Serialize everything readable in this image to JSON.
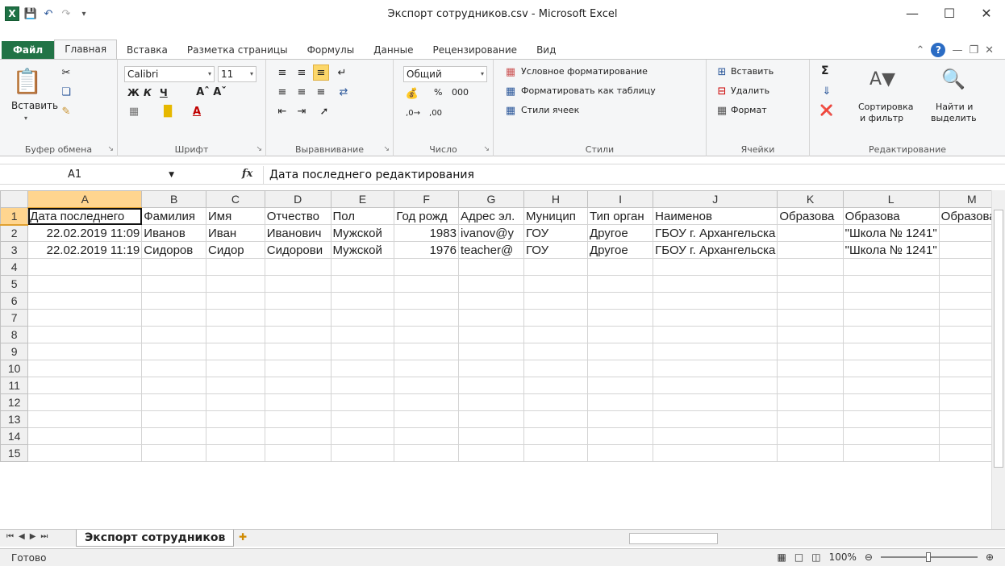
{
  "window": {
    "title": "Экспорт сотрудников.csv - Microsoft Excel",
    "app_icon": "X"
  },
  "ribbon_tabs": [
    "Файл",
    "Главная",
    "Вставка",
    "Разметка страницы",
    "Формулы",
    "Данные",
    "Рецензирование",
    "Вид"
  ],
  "ribbon": {
    "clipboard": {
      "paste": "Вставить",
      "label": "Буфер обмена"
    },
    "font": {
      "name": "Calibri",
      "size": "11",
      "label": "Шрифт",
      "bold": "Ж",
      "italic": "К",
      "underline": "Ч"
    },
    "alignment": {
      "label": "Выравнивание"
    },
    "number": {
      "format": "Общий",
      "percent": "%",
      "thousands": "000",
      "label": "Число"
    },
    "styles": {
      "conditional": "Условное форматирование",
      "as_table": "Форматировать как таблицу",
      "cell_styles": "Стили ячеек",
      "label": "Стили"
    },
    "cells": {
      "insert": "Вставить",
      "delete": "Удалить",
      "format": "Формат",
      "label": "Ячейки"
    },
    "editing": {
      "sum": "Σ",
      "sort_line1": "Сортировка",
      "sort_line2": "и фильтр",
      "find_line1": "Найти и",
      "find_line2": "выделить",
      "label": "Редактирование"
    }
  },
  "formula_bar": {
    "name_box": "A1",
    "fx": "fx",
    "content": "Дата последнего редактирования"
  },
  "sheet": {
    "columns": [
      "A",
      "B",
      "C",
      "D",
      "E",
      "F",
      "G",
      "H",
      "I",
      "J",
      "K",
      "L",
      "M"
    ],
    "row_numbers": [
      "1",
      "2",
      "3",
      "4",
      "5",
      "6",
      "7",
      "8",
      "9",
      "10",
      "11",
      "12",
      "13",
      "14",
      "15"
    ],
    "rows": [
      [
        "Дата последнего",
        "Фамилия",
        "Имя",
        "Отчество",
        "Пол",
        "Год рожд",
        "Адрес эл.",
        "Муницип",
        "Тип орган",
        "Наименов",
        "Образова",
        "Образова",
        "Образова"
      ],
      [
        "22.02.2019 11:09",
        "Иванов",
        "Иван",
        "Иванович",
        "Мужской",
        "1983",
        "ivanov@y",
        "ГОУ",
        "Другое",
        "ГБОУ г. Архангельска",
        "",
        "\"Школа № 1241\"",
        ""
      ],
      [
        "22.02.2019 11:19",
        "Сидоров",
        "Сидор",
        "Сидорови",
        "Мужской",
        "1976",
        "teacher@",
        "ГОУ",
        "Другое",
        "ГБОУ г. Архангельска",
        "",
        "\"Школа № 1241\"",
        ""
      ]
    ]
  },
  "sheet_tabs": [
    "Экспорт сотрудников"
  ],
  "status": {
    "ready": "Готово",
    "zoom": "100%"
  }
}
